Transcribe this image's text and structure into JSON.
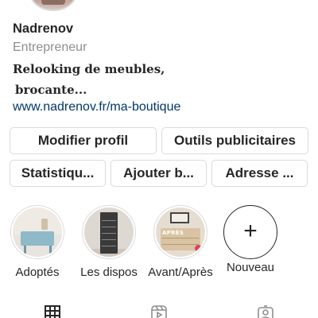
{
  "profile": {
    "username": "Nadrenov",
    "category": "Entrepreneur",
    "bio_line1": "Relooking de meubles,",
    "bio_line2": "brocante...",
    "website": "www.nadrenov.fr/ma-boutique"
  },
  "actions": {
    "edit_profile": "Modifier profil",
    "ad_tools": "Outils publicitaires",
    "statistics": "Statistiqu...",
    "add_button": "Ajouter b...",
    "address": "Adresse ..."
  },
  "highlights": [
    {
      "label": "Adoptés"
    },
    {
      "label": "Les dispos"
    },
    {
      "label": "Avant/Après",
      "image_tag": "APRÈS"
    },
    {
      "label": "Nouveau"
    }
  ],
  "tabs": {
    "icons": [
      "grid-icon",
      "reels-icon",
      "tagged-icon"
    ]
  },
  "colors": {
    "link": "#00376b",
    "secondary_text": "#8e8e8e",
    "border": "#dbdbdb"
  }
}
